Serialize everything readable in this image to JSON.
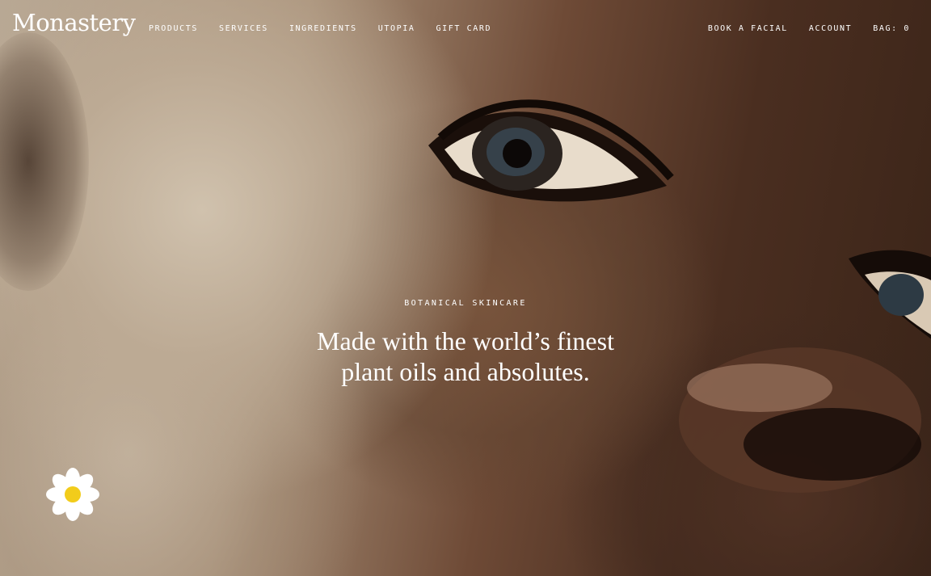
{
  "brand": {
    "logo_text": "Monastery"
  },
  "nav": {
    "left": [
      {
        "label": "PRODUCTS"
      },
      {
        "label": "SERVICES"
      },
      {
        "label": "INGREDIENTS"
      },
      {
        "label": "UTOPIA"
      },
      {
        "label": "GIFT CARD"
      }
    ],
    "right": [
      {
        "label": "BOOK A FACIAL"
      },
      {
        "label": "ACCOUNT"
      },
      {
        "label": "BAG: 0"
      }
    ]
  },
  "hero": {
    "eyebrow": "BOTANICAL SKINCARE",
    "headline_line1": "Made with the world’s finest",
    "headline_line2": "plant oils and absolutes."
  },
  "icons": {
    "daisy": "daisy-flower-icon"
  },
  "colors": {
    "text": "#ffffff",
    "flower_petal": "#ffffff",
    "flower_center": "#f2cc1b"
  }
}
